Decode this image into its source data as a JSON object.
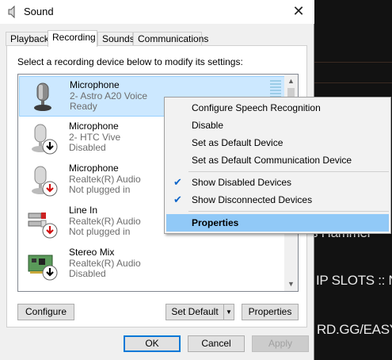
{
  "window": {
    "title": "Sound",
    "close_label": "✕"
  },
  "tabs": [
    {
      "label": "Playback"
    },
    {
      "label": "Recording"
    },
    {
      "label": "Sounds"
    },
    {
      "label": "Communications"
    }
  ],
  "instruction": "Select a recording device below to modify its settings:",
  "devices": [
    {
      "name": "Microphone",
      "sub": "2- Astro A20 Voice",
      "status": "Ready"
    },
    {
      "name": "Microphone",
      "sub": "2- HTC Vive",
      "status": "Disabled"
    },
    {
      "name": "Microphone",
      "sub": "Realtek(R) Audio",
      "status": "Not plugged in"
    },
    {
      "name": "Line In",
      "sub": "Realtek(R) Audio",
      "status": "Not plugged in"
    },
    {
      "name": "Stereo Mix",
      "sub": "Realtek(R) Audio",
      "status": "Disabled"
    }
  ],
  "buttons": {
    "configure": "Configure",
    "set_default": "Set Default",
    "properties": "Properties",
    "ok": "OK",
    "cancel": "Cancel",
    "apply": "Apply"
  },
  "context_menu": [
    {
      "label": "Configure Speech Recognition"
    },
    {
      "label": "Disable"
    },
    {
      "label": "Set as Default Device"
    },
    {
      "label": "Set as Default Communication Device"
    },
    {
      "label": "Show Disabled Devices",
      "checked": "✔"
    },
    {
      "label": "Show Disconnected Devices",
      "checked": "✔"
    },
    {
      "label": "Properties"
    }
  ],
  "background_app": {
    "lines": [
      "s Hammer",
      "IP SLOTS :: NIT",
      "RD.GG/EASYCO"
    ]
  },
  "colors": {
    "selected_bg": "#cce8ff",
    "menu_highlight": "#91c9f7",
    "disabled_badge": "#000000",
    "unplugged_badge": "#d01010",
    "accent": "#0078d7"
  }
}
